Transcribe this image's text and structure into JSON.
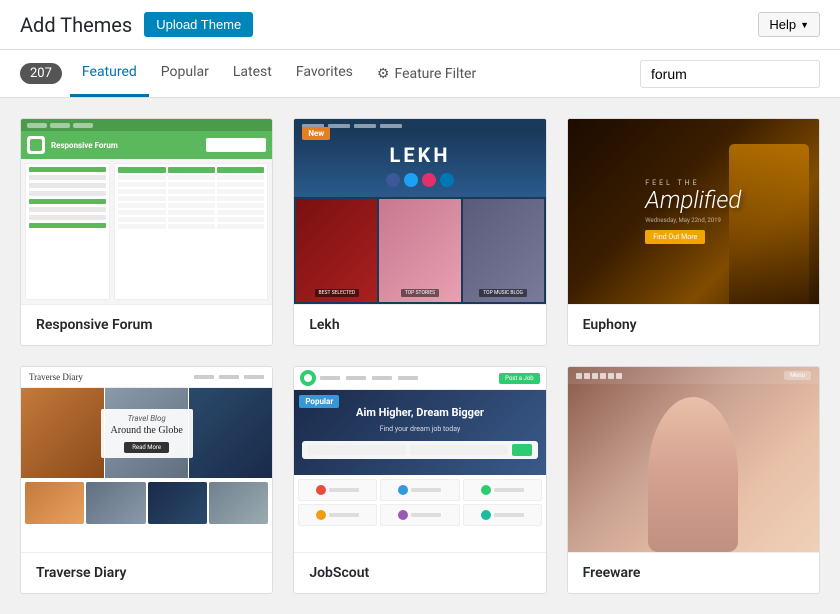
{
  "header": {
    "title": "Add Themes",
    "upload_btn": "Upload Theme",
    "help_btn": "Help"
  },
  "nav": {
    "count": "207",
    "tabs": [
      {
        "id": "featured",
        "label": "Featured",
        "active": true
      },
      {
        "id": "popular",
        "label": "Popular",
        "active": false
      },
      {
        "id": "latest",
        "label": "Latest",
        "active": false
      },
      {
        "id": "favorites",
        "label": "Favorites",
        "active": false
      },
      {
        "id": "feature-filter",
        "label": "Feature Filter",
        "active": false
      }
    ],
    "search_placeholder": "forum",
    "search_value": "forum"
  },
  "themes": [
    {
      "id": "responsive-forum",
      "name": "Responsive Forum",
      "type": "forum"
    },
    {
      "id": "lekh",
      "name": "Lekh",
      "badge": "New",
      "type": "blog"
    },
    {
      "id": "euphony",
      "name": "Euphony",
      "type": "music",
      "tagline": "Feel the Amplified",
      "label1": "FEEL THE",
      "label2": "Amplified"
    },
    {
      "id": "traverse-diary",
      "name": "Traverse Diary",
      "type": "travel",
      "tagline": "Around the Globe"
    },
    {
      "id": "jobscout",
      "name": "JobScout",
      "badge": "Popular",
      "type": "jobs",
      "tagline": "Aim Higher, Dream Bigger"
    },
    {
      "id": "freeware",
      "name": "Freeware",
      "type": "portfolio"
    }
  ],
  "lekh_social_icons": [
    {
      "color": "#3b5998"
    },
    {
      "color": "#1da1f2"
    },
    {
      "color": "#e1306c"
    },
    {
      "color": "#0077b5"
    }
  ],
  "js_categories": [
    {
      "color": "#e74c3c"
    },
    {
      "color": "#3498db"
    },
    {
      "color": "#2ecc71"
    },
    {
      "color": "#f39c12"
    },
    {
      "color": "#9b59b6"
    },
    {
      "color": "#1abc9c"
    }
  ]
}
